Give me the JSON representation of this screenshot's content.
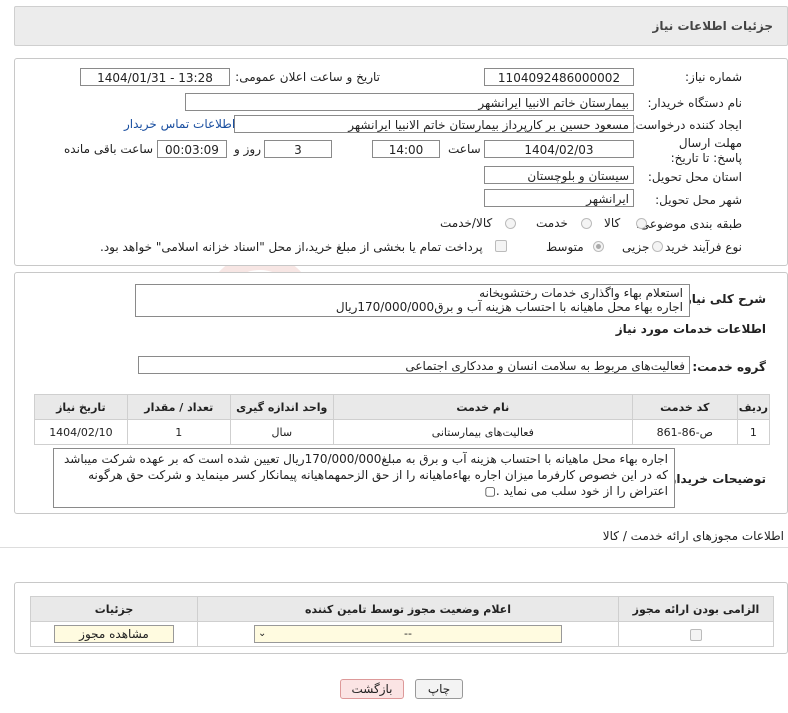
{
  "header": {
    "title": "جزئیات اطلاعات نیاز"
  },
  "form": {
    "need_number_label": "شماره نیاز:",
    "need_number": "1104092486000002",
    "announce_label": "تاریخ و ساعت اعلان عمومی:",
    "announce_value": "1404/01/31 - 13:28",
    "buyer_org_label": "نام دستگاه خریدار:",
    "buyer_org": "بیمارستان خاتم الانبیا ایرانشهر",
    "creator_label": "ایجاد کننده درخواست:",
    "creator": "مسعود حسین بر کارپرداز بیمارستان خاتم الانبیا ایرانشهر",
    "contact_link": "اطلاعات تماس خریدار",
    "deadline_label": "مهلت ارسال پاسخ: تا تاریخ:",
    "deadline_date": "1404/02/03",
    "time_label": "ساعت",
    "deadline_time": "14:00",
    "days_value": "3",
    "days_label": "روز و",
    "remaining_time": "00:03:09",
    "remaining_label": "ساعت باقی مانده",
    "province_label": "استان محل تحویل:",
    "province": "سیستان و بلوچستان",
    "city_label": "شهر محل تحویل:",
    "city": "ایرانشهر",
    "category_label": "طبقه بندی موضوعی:",
    "category_options": [
      "کالا",
      "خدمت",
      "کالا/خدمت"
    ],
    "purchase_type_label": "نوع فرآیند خرید :",
    "purchase_options": [
      "جزیی",
      "متوسط"
    ],
    "treasury_note": "پرداخت تمام یا بخشی از مبلغ خرید،از محل \"اسناد خزانه اسلامی\" خواهد بود."
  },
  "summary": {
    "label": "شرح کلی نیاز:",
    "line1": "استعلام بهاء واگذاری خدمات رختشویخانه",
    "line2": "اجاره بهاء محل ماهیانه  با احتساب هزینه آب و برق170/000/000ریال"
  },
  "services": {
    "title": "اطلاعات خدمات مورد نیاز",
    "group_label": "گروه خدمت:",
    "group_value": "فعالیت‌های مربوط به سلامت انسان و مددکاری اجتماعی",
    "columns": [
      "ردیف",
      "کد خدمت",
      "نام خدمت",
      "واحد اندازه گیری",
      "تعداد / مقدار",
      "تاریخ نیاز"
    ],
    "rows": [
      {
        "row": "1",
        "code": "ص-86-861",
        "name": "فعالیت‌های بیمارستانی",
        "unit": "سال",
        "qty": "1",
        "date": "1404/02/10"
      }
    ]
  },
  "buyer_notes": {
    "label": "توضیحات خریدار:",
    "text": "اجاره بهاء محل ماهیانه  با احتساب هزینه آب و برق به مبلغ170/000/000ریال تعیین شده است که بر عهده شرکت میباشد که در این خصوص کارفرما میزان اجاره بهاءماهیانه را از حق الزحمهماهیانه پیمانکار کسر مینماید و شرکت حق هرگونه اعتراض را از خود سلب می نماید .▢"
  },
  "permits": {
    "title": "اطلاعات مجوزهای ارائه خدمت / کالا",
    "columns": [
      "الزامی بودن ارائه مجوز",
      "اعلام وضعیت مجوز توسط تامین کننده",
      "جزئیات"
    ],
    "select_value": "--",
    "view_button": "مشاهده مجوز"
  },
  "footer": {
    "print_button": "چاپ",
    "back_button": "بازگشت"
  }
}
